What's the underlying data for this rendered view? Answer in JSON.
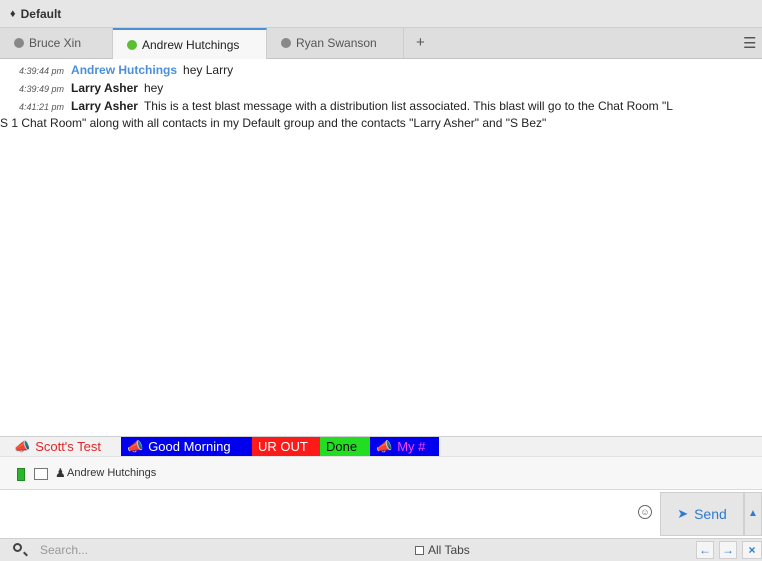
{
  "window": {
    "title": "Default"
  },
  "tabs": [
    {
      "label": "Bruce Xin",
      "status_color": "#888888"
    },
    {
      "label": "Andrew Hutchings",
      "status_color": "#5cbf32"
    },
    {
      "label": "Ryan Swanson",
      "status_color": "#888888"
    }
  ],
  "tab_add": "+",
  "menu_icon": "hamburger-menu-icon",
  "messages": [
    {
      "time": "4:39:44 pm",
      "sender": "Andrew Hutchings",
      "sender_color": "#4a90d9",
      "text": "hey Larry"
    },
    {
      "time": "4:39:49 pm",
      "sender": "Larry Asher",
      "sender_color": "#222222",
      "text": "hey"
    },
    {
      "time": "4:41:21 pm",
      "sender": "Larry Asher",
      "sender_color": "#222222",
      "text": "This is a test blast message with a distribution list associated.  This blast will go to the Chat Room \"L",
      "continuation": "S 1 Chat Room\" along with all contacts in my Default group and the contacts \"Larry Asher\" and \"S Bez\""
    }
  ],
  "quick_replies": [
    {
      "label": "Scott's Test",
      "icon": "megaphone-icon",
      "bg": "#f1f1f1",
      "fg": "#e0262b"
    },
    {
      "label": "Good Morning",
      "icon": "megaphone-icon",
      "bg": "#0000ee",
      "fg": "#ffffff"
    },
    {
      "label": "UR OUT",
      "icon": "",
      "bg": "#ff1a1a",
      "fg": "#ffffff"
    },
    {
      "label": "Done",
      "icon": "",
      "bg": "#22dd22",
      "fg": "#111111"
    },
    {
      "label": "My #",
      "icon": "megaphone-icon",
      "bg": "#0000ee",
      "fg": "#ff44ff"
    }
  ],
  "info": {
    "contact_name": "Andrew Hutchings"
  },
  "compose": {
    "send_label": "Send"
  },
  "bottom": {
    "search_placeholder": "Search...",
    "all_tabs_label": "All Tabs"
  }
}
